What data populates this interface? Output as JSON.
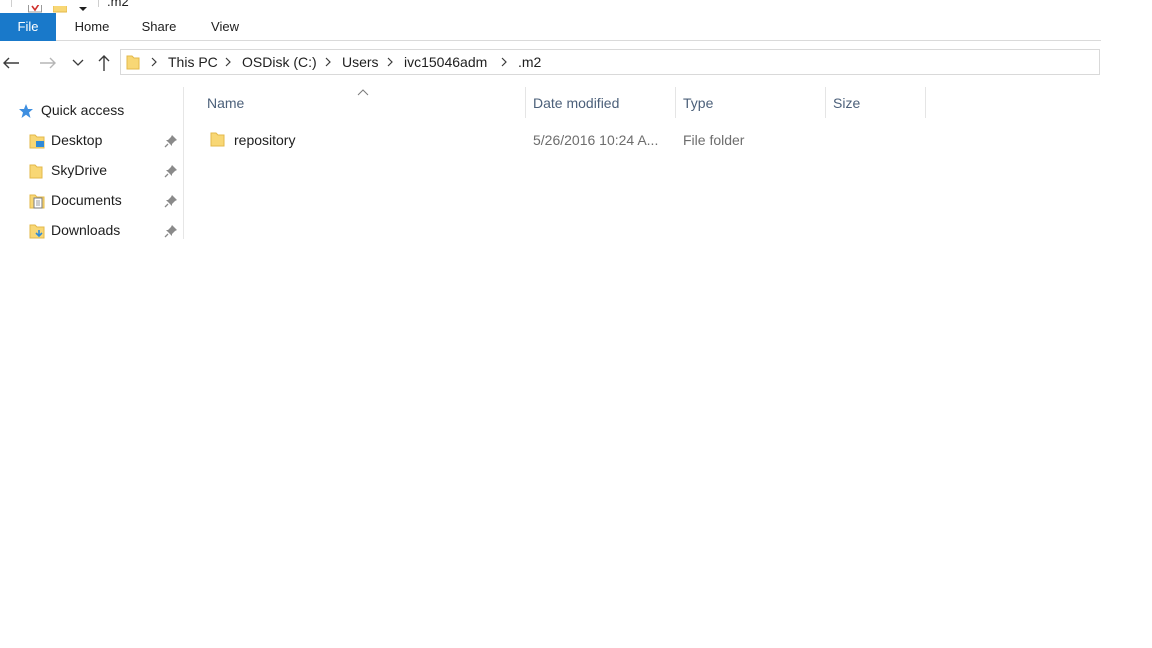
{
  "window": {
    "title": ".m2"
  },
  "ribbon": {
    "tabs": [
      {
        "label": "File"
      },
      {
        "label": "Home"
      },
      {
        "label": "Share"
      },
      {
        "label": "View"
      }
    ]
  },
  "address_bar": {
    "breadcrumbs": [
      "This PC",
      "OSDisk (C:)",
      "Users",
      "ivc15046adm",
      ".m2"
    ]
  },
  "nav_pane": {
    "quick_access": "Quick access",
    "items": [
      {
        "label": "Desktop",
        "icon": "desktop-folder-icon"
      },
      {
        "label": "SkyDrive",
        "icon": "folder-icon"
      },
      {
        "label": "Documents",
        "icon": "documents-folder-icon"
      },
      {
        "label": "Downloads",
        "icon": "downloads-folder-icon"
      }
    ]
  },
  "file_list": {
    "columns": [
      "Name",
      "Date modified",
      "Type",
      "Size"
    ],
    "rows": [
      {
        "name": "repository",
        "date_modified": "5/26/2016 10:24 A...",
        "type": "File folder",
        "size": ""
      }
    ]
  },
  "colors": {
    "file_tab": "#1979ca",
    "folder_yellow": "#f8d775",
    "header_text": "#4c607a",
    "secondary_text": "#6d6d6d"
  }
}
